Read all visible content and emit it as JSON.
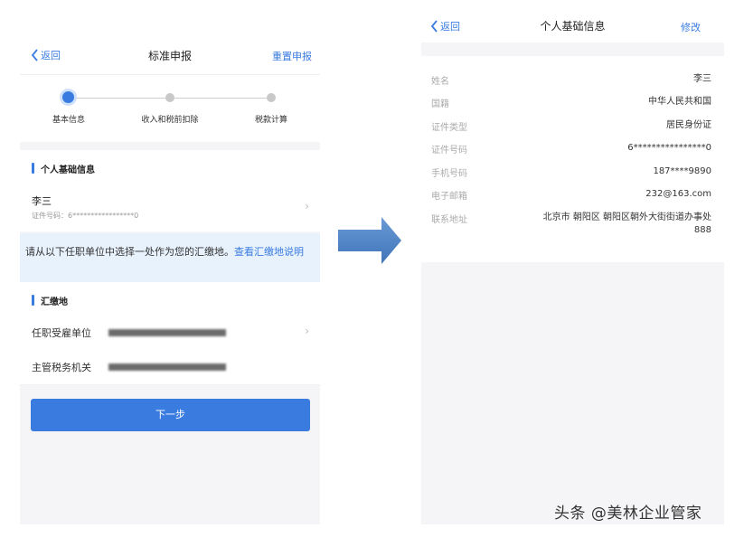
{
  "left": {
    "nav": {
      "back_label": "返回",
      "title": "标准申报",
      "action_label": "重置申报"
    },
    "steps": [
      {
        "label": "基本信息",
        "active": true
      },
      {
        "label": "收入和税前扣除",
        "active": false
      },
      {
        "label": "税款计算",
        "active": false
      }
    ],
    "personal_section": {
      "title": "个人基础信息"
    },
    "person": {
      "name": "李三",
      "id_text": "证件号码：6*****************0"
    },
    "notice": {
      "text": "请从以下任职单位中选择一处作为您的汇缴地。",
      "link": "查看汇缴地说明"
    },
    "payment_section": {
      "title": "汇缴地"
    },
    "rows": [
      {
        "label": "任职受雇单位"
      },
      {
        "label": "主管税务机关"
      }
    ],
    "next_button": "下一步"
  },
  "right": {
    "nav": {
      "back_label": "返回",
      "title": "个人基础信息",
      "action_label": "修改"
    },
    "fields": [
      {
        "label": "姓名",
        "value": "李三"
      },
      {
        "label": "国籍",
        "value": "中华人民共和国"
      },
      {
        "label": "证件类型",
        "value": "居民身份证"
      },
      {
        "label": "证件号码",
        "value": "6****************0"
      },
      {
        "label": "手机号码",
        "value": "187****9890"
      },
      {
        "label": "电子邮箱",
        "value": "232@163.com"
      },
      {
        "label": "联系地址",
        "value": "北京市 朝阳区 朝阳区朝外大街街道办事处 888"
      }
    ]
  },
  "watermark": "头条 @美林企业管家",
  "colors": {
    "accent": "#3a7be0",
    "notice_bg": "#e8f2fd",
    "arrow": "#4a80c4"
  }
}
